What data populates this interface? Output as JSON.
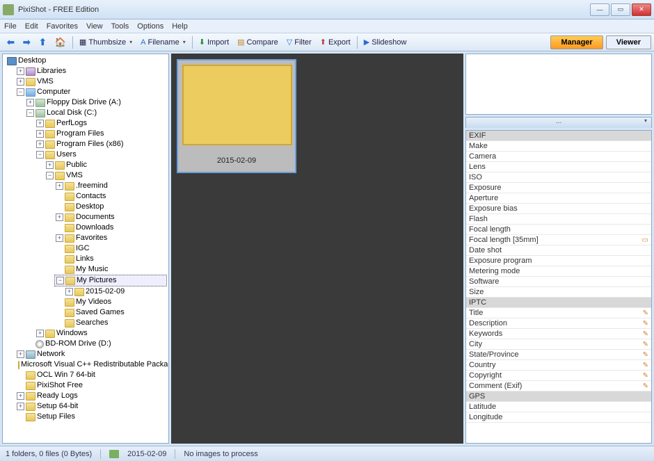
{
  "window": {
    "title": "PixiShot  -  FREE Edition"
  },
  "menu": {
    "file": "File",
    "edit": "Edit",
    "favorites": "Favorites",
    "view": "View",
    "tools": "Tools",
    "options": "Options",
    "help": "Help"
  },
  "toolbar": {
    "thumbsize": "Thumbsize",
    "filename": "Filename",
    "import": "Import",
    "compare": "Compare",
    "filter": "Filter",
    "export": "Export",
    "slideshow": "Slideshow",
    "manager": "Manager",
    "viewer": "Viewer"
  },
  "tree": {
    "desktop": "Desktop",
    "libraries": "Libraries",
    "vms": "VMS",
    "computer": "Computer",
    "floppy": "Floppy Disk Drive (A:)",
    "localdisk": "Local Disk (C:)",
    "perflogs": "PerfLogs",
    "programfiles": "Program Files",
    "programfilesx86": "Program Files (x86)",
    "users": "Users",
    "public": "Public",
    "vms2": "VMS",
    "freemind": ".freemind",
    "contacts": "Contacts",
    "desktop2": "Desktop",
    "documents": "Documents",
    "downloads": "Downloads",
    "favorites": "Favorites",
    "igc": "IGC",
    "links": "Links",
    "mymusic": "My Music",
    "mypictures": "My Pictures",
    "date_folder": "2015-02-09",
    "myvideos": "My Videos",
    "savedgames": "Saved Games",
    "searches": "Searches",
    "windows": "Windows",
    "bdrom": "BD-ROM Drive (D:)",
    "network": "Network",
    "msvcpp": "Microsoft Visual C++ Redistributable Package",
    "ocl": "OCL Win 7 64-bit",
    "pixishot": "PixiShot Free",
    "readylogs": "Ready Logs",
    "setup64": "Setup 64-bit",
    "setupfiles": "Setup Files"
  },
  "thumb": {
    "label": "2015-02-09"
  },
  "meta_head": "...",
  "meta": {
    "exif": "EXIF",
    "make": "Make",
    "camera": "Camera",
    "lens": "Lens",
    "iso": "ISO",
    "exposure": "Exposure",
    "aperture": "Aperture",
    "exposure_bias": "Exposure bias",
    "flash": "Flash",
    "focal_length": "Focal length",
    "focal_length_35": "Focal length [35mm]",
    "date_shot": "Date shot",
    "exposure_program": "Exposure program",
    "metering": "Metering mode",
    "software": "Software",
    "size": "Size",
    "iptc": "IPTC",
    "title": "Title",
    "description": "Description",
    "keywords": "Keywords",
    "city": "City",
    "state": "State/Province",
    "country": "Country",
    "copyright": "Copyright",
    "comment": "Comment (Exif)",
    "gps": "GPS",
    "latitude": "Latitude",
    "longitude": "Longitude"
  },
  "status": {
    "counts": "1 folders,  0 files  (0 Bytes)",
    "date": "2015-02-09",
    "process": "No images to process"
  }
}
